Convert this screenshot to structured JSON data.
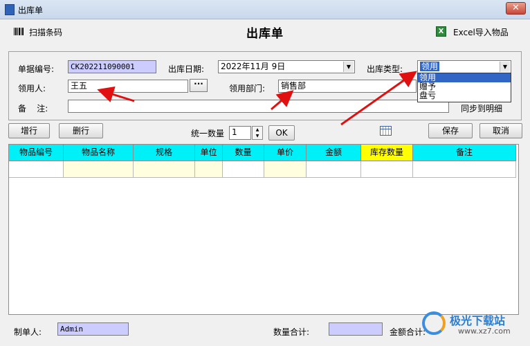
{
  "window": {
    "title": "出库单",
    "close_glyph": "✕"
  },
  "header": {
    "scan_label": "扫描条码",
    "page_title": "出库单",
    "excel_label": "Excel导入物品",
    "scan_icon": "barcode-icon",
    "excel_icon": "excel-icon"
  },
  "form": {
    "doc_no_label": "单据编号:",
    "doc_no_value": "CK202211090001",
    "date_label": "出库日期:",
    "date_value": "2022年11月 9日",
    "type_label": "出库类型:",
    "type_value": "领用",
    "receiver_label": "领用人:",
    "receiver_value": "王五",
    "browse_label": "···",
    "dept_label": "领用部门:",
    "dept_value": "销售部",
    "note_label": "备    注:",
    "note_value": "",
    "sync_label": "同步到明细",
    "type_options": [
      "领用",
      "赠予",
      "盘亏"
    ],
    "type_selected_index": 0
  },
  "actions": {
    "add_row": "增行",
    "del_row": "删行",
    "qty_label": "统一数量",
    "qty_value": "1",
    "ok": "OK",
    "save": "保存",
    "cancel": "取消",
    "spin_up": "▲",
    "spin_down": "▼",
    "grid_icon": "table-grid-icon"
  },
  "table": {
    "columns": [
      "物品编号",
      "物品名称",
      "规格",
      "单位",
      "数量",
      "单价",
      "金额",
      "库存数量",
      "备注"
    ],
    "highlight_column": "库存数量",
    "header_color": "#00f0f8",
    "highlight_color": "#ffff00",
    "editable_color": "#ffffe0",
    "rows": [
      [
        "",
        "",
        "",
        "",
        "",
        "",
        "",
        "",
        ""
      ]
    ]
  },
  "footer": {
    "maker_label": "制单人:",
    "maker_value": "Admin",
    "qty_total_label": "数量合计:",
    "qty_total_value": "",
    "amount_total_label": "金额合计:"
  },
  "watermark": {
    "brand": "极光下载站",
    "url": "www.xz7.com"
  },
  "colors": {
    "lavender_field": "#ccccff",
    "selection": "#3166c5",
    "arrow": "#e01010"
  }
}
